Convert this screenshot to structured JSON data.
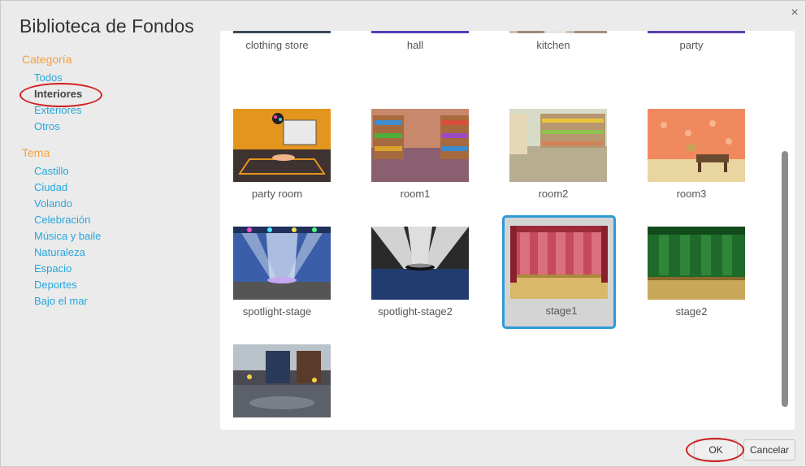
{
  "dialog": {
    "title": "Biblioteca de Fondos",
    "close_label": "×"
  },
  "sidebar": {
    "category_heading": "Categoría",
    "categories": [
      {
        "label": "Todos",
        "selected": false
      },
      {
        "label": "Interiores",
        "selected": true
      },
      {
        "label": "Exteriores",
        "selected": false
      },
      {
        "label": "Otros",
        "selected": false
      }
    ],
    "theme_heading": "Tema",
    "themes": [
      {
        "label": "Castillo"
      },
      {
        "label": "Ciudad"
      },
      {
        "label": "Volando"
      },
      {
        "label": "Celebración"
      },
      {
        "label": "Música y baile"
      },
      {
        "label": "Naturaleza"
      },
      {
        "label": "Espacio"
      },
      {
        "label": "Deportes"
      },
      {
        "label": "Bajo el mar"
      }
    ]
  },
  "library": {
    "items": [
      {
        "name": "clothing store",
        "icon": "clothing-store-thumbnail"
      },
      {
        "name": "hall",
        "icon": "hall-thumbnail"
      },
      {
        "name": "kitchen",
        "icon": "kitchen-thumbnail"
      },
      {
        "name": "party",
        "icon": "party-thumbnail"
      },
      {
        "name": "party room",
        "icon": "party-room-thumbnail"
      },
      {
        "name": "room1",
        "icon": "room1-thumbnail"
      },
      {
        "name": "room2",
        "icon": "room2-thumbnail"
      },
      {
        "name": "room3",
        "icon": "room3-thumbnail"
      },
      {
        "name": "spotlight-stage",
        "icon": "spotlight-stage-thumbnail"
      },
      {
        "name": "spotlight-stage2",
        "icon": "spotlight-stage2-thumbnail"
      },
      {
        "name": "stage1",
        "icon": "stage1-thumbnail",
        "selected": true
      },
      {
        "name": "stage2",
        "icon": "stage2-thumbnail"
      },
      {
        "name": "",
        "icon": "theater-lobby-thumbnail"
      }
    ]
  },
  "footer": {
    "ok_label": "OK",
    "cancel_label": "Cancelar"
  },
  "colors": {
    "accent": "#2e9ad6",
    "category_heading": "#f3a03c",
    "link": "#26a6dc",
    "annotation": "#d11f1f"
  }
}
